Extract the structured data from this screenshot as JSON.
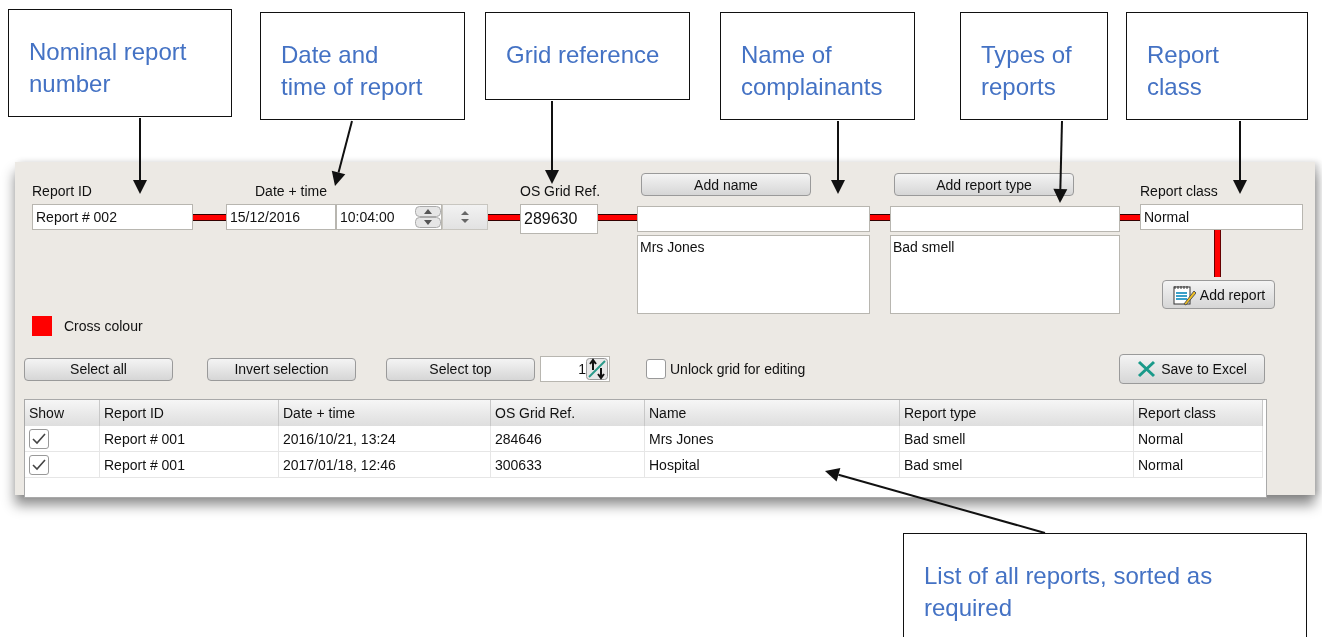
{
  "callouts": [
    {
      "text": "Nominal report\nnumber"
    },
    {
      "text": "Date and\ntime of report"
    },
    {
      "text": "Grid reference"
    },
    {
      "text": "Name of\ncomplainants"
    },
    {
      "text": "Types of\nreports"
    },
    {
      "text": "Report\nclass"
    },
    {
      "text": "List of all reports, sorted as\nrequired"
    }
  ],
  "form": {
    "report_id": {
      "label": "Report ID",
      "value": "Report # 002"
    },
    "date_time": {
      "label": "Date + time",
      "date": "15/12/2016",
      "time": "10:04:00"
    },
    "grid_ref": {
      "label": "OS Grid Ref.",
      "value": "289630"
    },
    "name": {
      "button": "Add name",
      "list": [
        "Mrs Jones"
      ]
    },
    "report_type": {
      "button": "Add report type",
      "list": [
        "Bad smell"
      ]
    },
    "report_class": {
      "label": "Report class",
      "value": "Normal"
    },
    "add_report_button": "Add report",
    "cross_colour": {
      "label": "Cross colour",
      "color": "#ff0000"
    }
  },
  "toolbar": {
    "select_all": "Select all",
    "invert_selection": "Invert selection",
    "select_top": "Select top",
    "top_count": "1",
    "unlock": {
      "label": "Unlock grid for editing",
      "checked": false
    },
    "save_excel": "Save to Excel"
  },
  "table": {
    "show_column": "Show",
    "columns": [
      "Report ID",
      "Date + time",
      "OS Grid Ref.",
      "Name",
      "Report type",
      "Report class"
    ],
    "rows": [
      {
        "show": true,
        "cells": [
          "Report # 001",
          "2016/10/21, 13:24",
          "284646",
          "Mrs Jones",
          "Bad smell",
          "Normal"
        ]
      },
      {
        "show": true,
        "cells": [
          "Report # 001",
          "2017/01/18, 12:46",
          "300633",
          "Hospital",
          "Bad smel",
          "Normal"
        ]
      }
    ]
  }
}
